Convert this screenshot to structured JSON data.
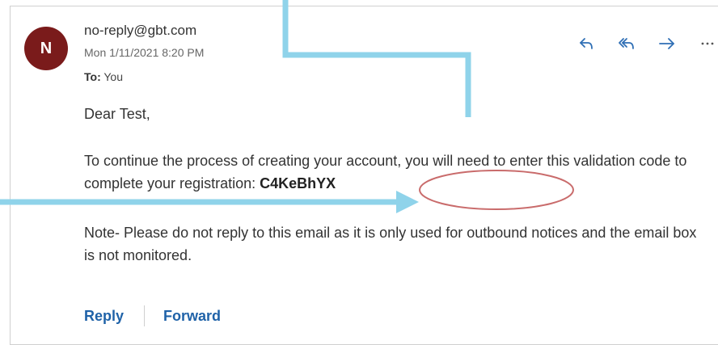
{
  "email": {
    "avatar_initial": "N",
    "sender": "no-reply@gbt.com",
    "date": "Mon 1/11/2021 8:20 PM",
    "to_label": "To:",
    "to_value": "You",
    "greeting": "Dear Test,",
    "para1_text": "To continue the process of creating your account, you will need to enter this validation code to complete your registration: ",
    "validation_code": "C4KeBhYX",
    "para2_text": "Note- Please do not reply to this email as it is only used for outbound notices and the email box is not monitored."
  },
  "toolbar": {
    "icons": [
      "reply-icon",
      "reply-all-icon",
      "forward-icon",
      "more-icon"
    ]
  },
  "footer": {
    "reply_label": "Reply",
    "forward_label": "Forward"
  },
  "annotations": {
    "arrow_color": "#8fd3ea",
    "circle_color": "#c96b6b",
    "avatar_color": "#7a1b1b",
    "link_color": "#1f62a8"
  }
}
